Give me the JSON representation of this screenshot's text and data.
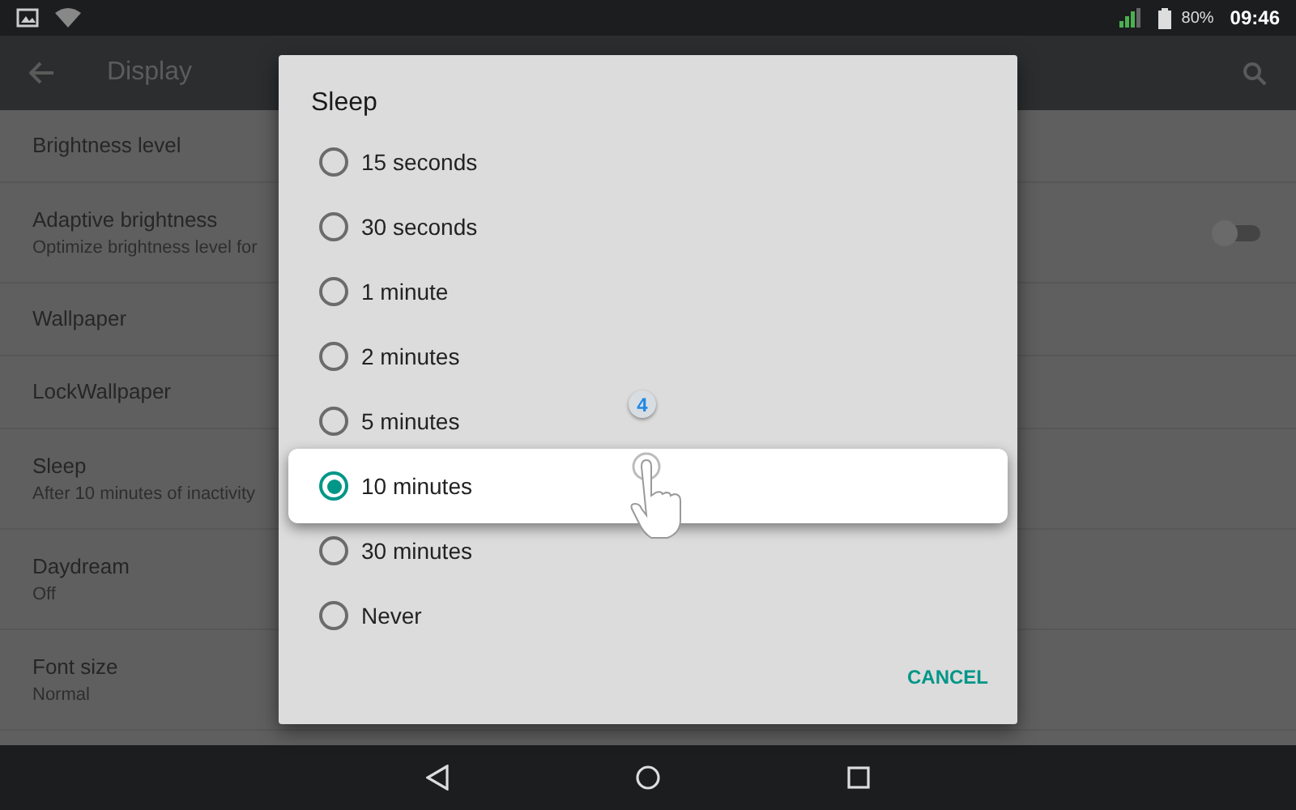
{
  "status_bar": {
    "battery": "80%",
    "time": "09:46"
  },
  "app_bar": {
    "title": "Display"
  },
  "settings": [
    {
      "title": "Brightness level"
    },
    {
      "title": "Adaptive brightness",
      "summary": "Optimize brightness level for",
      "kind": "switch",
      "on": false
    },
    {
      "title": "Wallpaper"
    },
    {
      "title": "LockWallpaper"
    },
    {
      "title": "Sleep",
      "summary": "After 10 minutes of inactivity"
    },
    {
      "title": "Daydream",
      "summary": "Off"
    },
    {
      "title": "Font size",
      "summary": "Normal"
    }
  ],
  "dialog": {
    "title": "Sleep",
    "options": [
      {
        "label": "15 seconds",
        "selected": false
      },
      {
        "label": "30 seconds",
        "selected": false
      },
      {
        "label": "1 minute",
        "selected": false
      },
      {
        "label": "2 minutes",
        "selected": false
      },
      {
        "label": "5 minutes",
        "selected": false
      },
      {
        "label": "10 minutes",
        "selected": true
      },
      {
        "label": "30 minutes",
        "selected": false
      },
      {
        "label": "Never",
        "selected": false
      }
    ],
    "cancel": "CANCEL"
  },
  "tutorial": {
    "step": "4"
  }
}
